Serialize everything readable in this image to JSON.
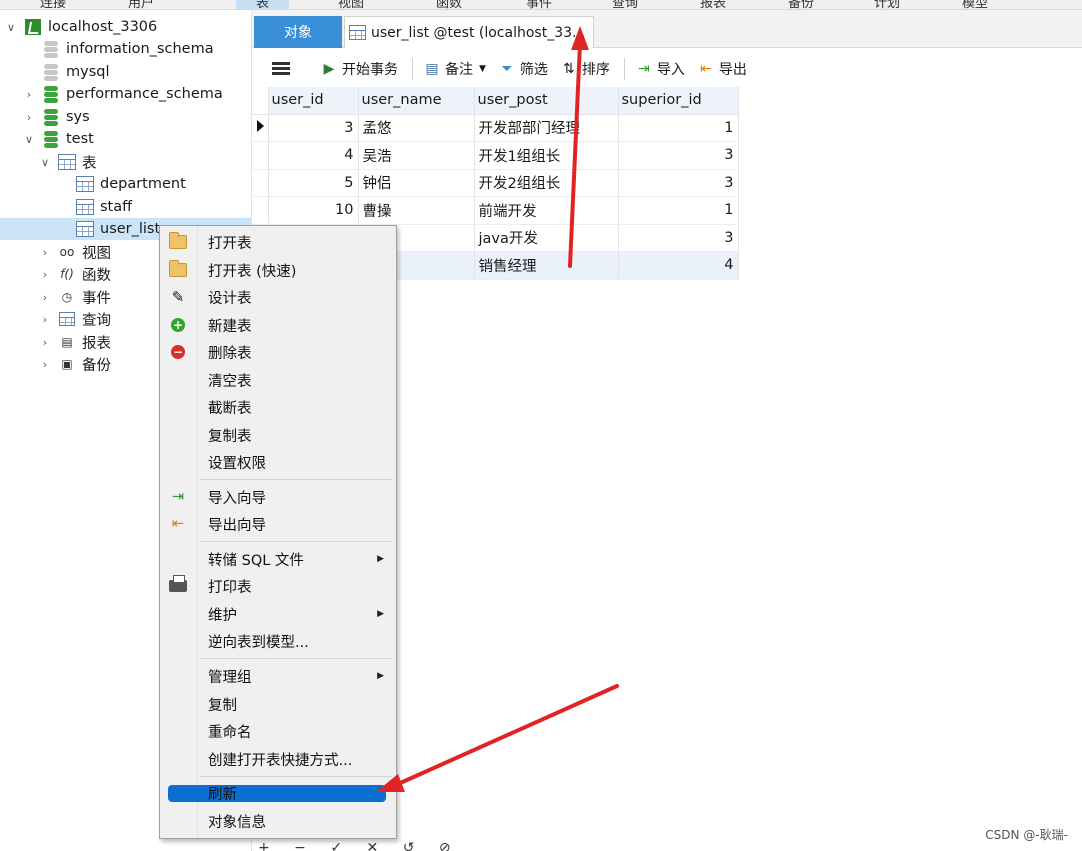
{
  "menu": {
    "items": [
      "连接",
      "用户",
      "表",
      "视图",
      "函数",
      "事件",
      "查询",
      "报表",
      "备份",
      "计划",
      "模型"
    ],
    "active": "表"
  },
  "navigator": {
    "connection": "localhost_3306",
    "databases": [
      {
        "name": "information_schema",
        "icon": "database-gray-icon"
      },
      {
        "name": "mysql",
        "icon": "database-gray-icon"
      },
      {
        "name": "performance_schema",
        "icon": "database-green-icon"
      },
      {
        "name": "sys",
        "icon": "database-green-icon"
      },
      {
        "name": "test",
        "icon": "database-green-icon"
      }
    ],
    "test_children": {
      "tables_label": "表",
      "tables": [
        "department",
        "staff",
        "user_list"
      ],
      "views_label": "视图",
      "functions_label": "函数",
      "events_label": "事件",
      "queries_label": "查询",
      "reports_label": "报表",
      "backups_label": "备份"
    }
  },
  "tabs": {
    "objects": "对象",
    "user_list": "user_list @test (localhost_33..."
  },
  "toolbar": {
    "begin_transaction": "开始事务",
    "memo": "备注",
    "filter": "筛选",
    "sort": "排序",
    "import": "导入",
    "export": "导出"
  },
  "table": {
    "columns": [
      "user_id",
      "user_name",
      "user_post",
      "superior_id"
    ],
    "rows": [
      {
        "user_id": "3",
        "user_name": "孟悠",
        "user_post": "开发部部门经理",
        "superior_id": "1"
      },
      {
        "user_id": "4",
        "user_name": "吴浩",
        "user_post": "开发1组组长",
        "superior_id": "3"
      },
      {
        "user_id": "5",
        "user_name": "钟侣",
        "user_post": "开发2组组长",
        "superior_id": "3"
      },
      {
        "user_id": "10",
        "user_name": "曹操",
        "user_post": "前端开发",
        "superior_id": "1"
      },
      {
        "user_id": "",
        "user_name": "",
        "user_post": "java开发",
        "superior_id": "3"
      },
      {
        "user_id": "",
        "user_name": "",
        "user_post": "销售经理",
        "superior_id": "4"
      }
    ]
  },
  "context_menu": {
    "items": [
      "打开表",
      "打开表 (快速)",
      "设计表",
      "新建表",
      "删除表",
      "清空表",
      "截断表",
      "复制表",
      "设置权限",
      "导入向导",
      "导出向导",
      "转储 SQL 文件",
      "打印表",
      "维护",
      "逆向表到模型...",
      "管理组",
      "复制",
      "重命名",
      "创建打开表快捷方式...",
      "刷新",
      "对象信息"
    ],
    "highlighted": "刷新"
  },
  "bottom_glyphs": "+ − ✓ ✕ ↺ ⊘",
  "watermark": "CSDN @-耿瑞-",
  "colors": {
    "accent_blue": "#3a8fd9",
    "highlight": "#0a6fd1",
    "arrow_red": "#e02424",
    "db_green": "#3aa63a"
  }
}
